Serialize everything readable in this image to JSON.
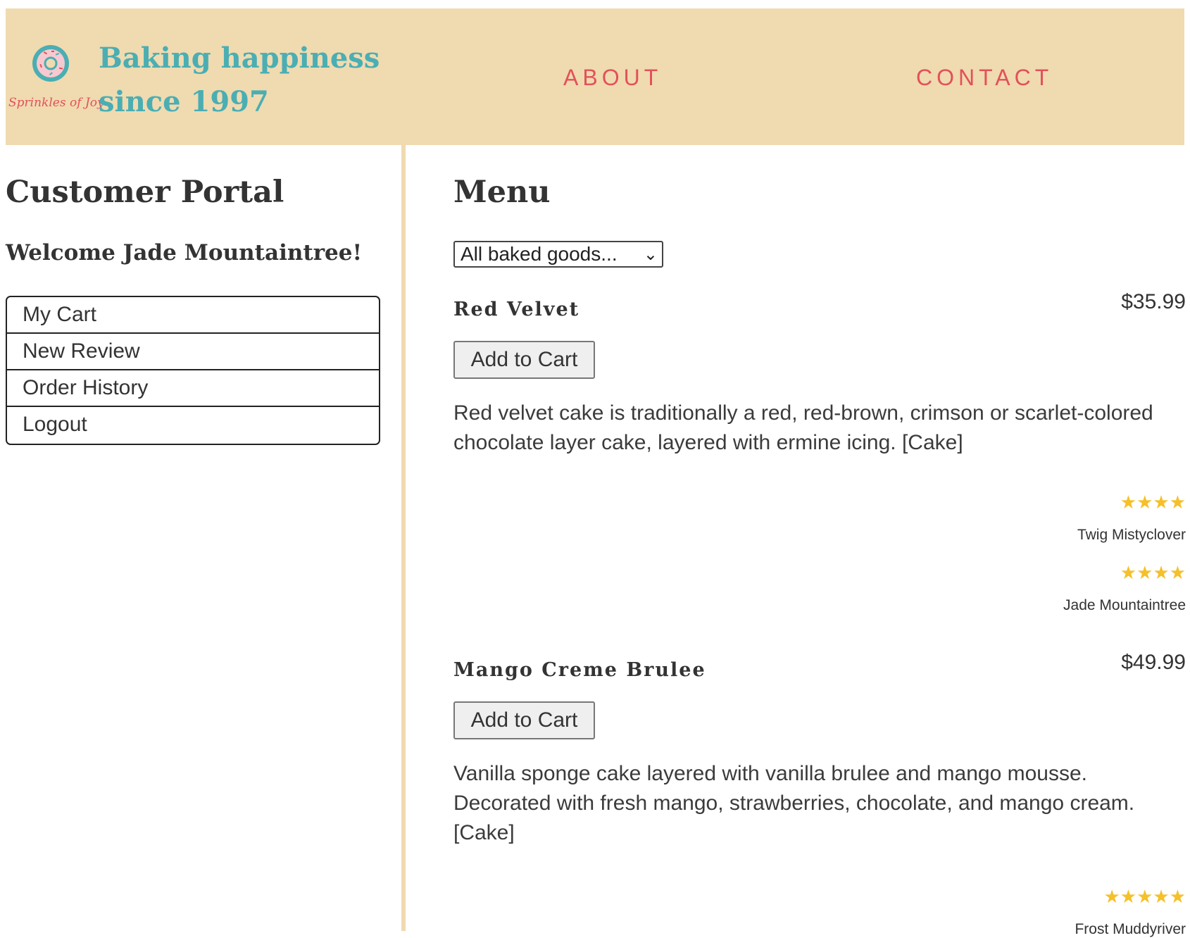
{
  "header": {
    "logo_text": "Sprinkles of Joy",
    "tagline": "Baking happiness\nsince 1997",
    "nav": {
      "about": "ABOUT",
      "contact": "CONTACT"
    }
  },
  "sidebar": {
    "title": "Customer Portal",
    "welcome": "Welcome Jade Mountaintree!",
    "items": [
      {
        "label": "My Cart"
      },
      {
        "label": "New Review"
      },
      {
        "label": "Order History"
      },
      {
        "label": "Logout"
      }
    ]
  },
  "main": {
    "title": "Menu",
    "category_select": {
      "selected": "All baked goods..."
    },
    "products": [
      {
        "name": "Red Velvet",
        "price": "$35.99",
        "button_label": "Add to Cart",
        "description": "Red velvet cake is traditionally a red, red-brown, crimson or scarlet-colored chocolate layer cake, layered with ermine icing. [Cake]",
        "reviews": [
          {
            "stars": "★★★★",
            "rating": 4,
            "reviewer": "Twig Mistyclover"
          },
          {
            "stars": "★★★★",
            "rating": 4,
            "reviewer": "Jade Mountaintree"
          }
        ]
      },
      {
        "name": "Mango Creme Brulee",
        "price": "$49.99",
        "button_label": "Add to Cart",
        "description": "Vanilla sponge cake layered with vanilla brulee and mango mousse. Decorated with fresh mango, strawberries, chocolate, and mango cream. [Cake]",
        "reviews": [
          {
            "stars": "★★★★★",
            "rating": 5,
            "reviewer": "Frost Muddyriver"
          }
        ]
      }
    ]
  },
  "colors": {
    "header_bg": "#f0dab0",
    "teal": "#4aaeb3",
    "coral": "#e2515b",
    "star": "#f5c029"
  }
}
